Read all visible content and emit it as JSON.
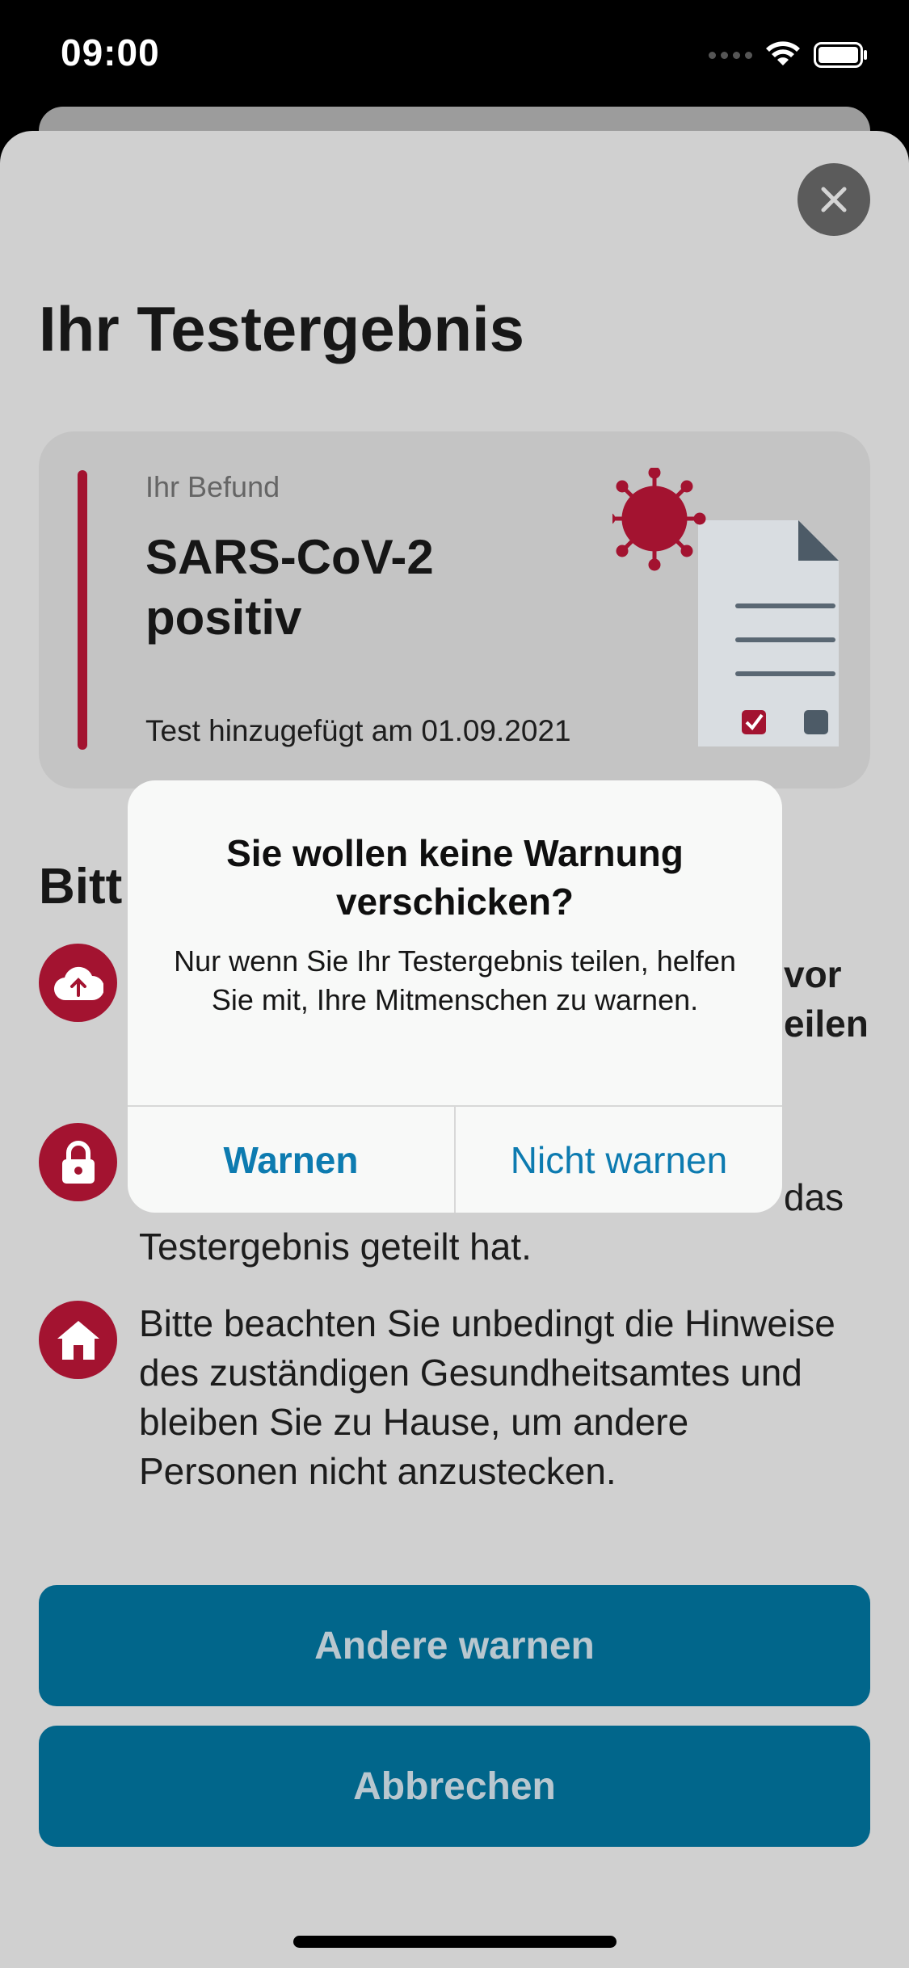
{
  "status_bar": {
    "time": "09:00"
  },
  "header": {
    "title": "Ihr Testergebnis",
    "close_icon": "close-icon"
  },
  "result": {
    "label": "Ihr Befund",
    "title_line1": "SARS-CoV-2",
    "title_line2": "positiv",
    "date": "Test hinzugefügt am 01.09.2021",
    "accent_color": "#a31330"
  },
  "section": {
    "title_visible": "Bitt"
  },
  "info": [
    {
      "icon": "cloud-upload-icon",
      "visible_fragment_1": "vor",
      "visible_fragment_2": "eilen"
    },
    {
      "icon": "lock-icon",
      "visible_fragment_1": "das",
      "visible_line": "Testergebnis geteilt hat."
    },
    {
      "icon": "home-icon",
      "text": "Bitte beachten Sie unbedingt die Hinweise des zuständigen Gesundheitsamtes und bleiben Sie zu Hause, um andere Personen nicht anzustecken."
    }
  ],
  "buttons": {
    "warn": "Andere warnen",
    "cancel": "Abbrechen",
    "color": "#01668b"
  },
  "alert": {
    "title": "Sie wollen keine Warnung verschicken?",
    "message": "Nur wenn Sie Ihr Testergebnis teilen, helfen Sie mit, Ihre Mitmenschen zu warnen.",
    "confirm": "Warnen",
    "decline": "Nicht warnen",
    "accent_color": "#0d7bb0"
  }
}
